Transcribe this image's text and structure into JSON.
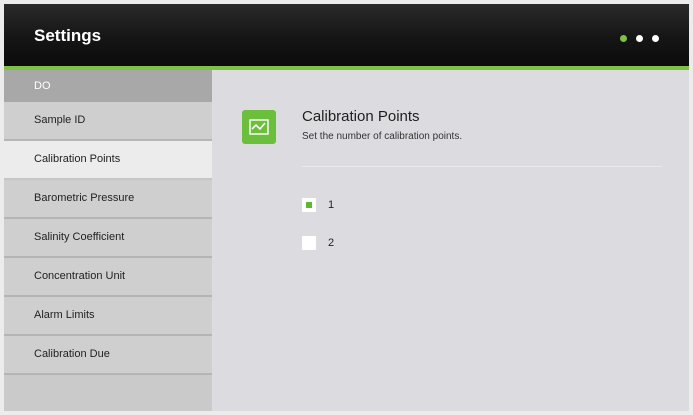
{
  "header": {
    "title": "Settings"
  },
  "sidebar": {
    "group_label": "DO",
    "items": [
      {
        "label": "Sample ID"
      },
      {
        "label": "Calibration Points"
      },
      {
        "label": "Barometric Pressure"
      },
      {
        "label": "Salinity Coefficient"
      },
      {
        "label": "Concentration Unit"
      },
      {
        "label": "Alarm Limits"
      },
      {
        "label": "Calibration Due"
      }
    ],
    "selected": "Calibration Points"
  },
  "main": {
    "icon": "chart-line-icon",
    "title": "Calibration Points",
    "description": "Set the number of calibration points.",
    "options": [
      {
        "label": "1",
        "selected": true
      },
      {
        "label": "2",
        "selected": false
      }
    ]
  },
  "colors": {
    "accent": "#7dc242",
    "header_bg": "#151515",
    "sidebar_bg": "#cacaca",
    "selected_bg": "#ececec",
    "main_bg": "#dcdce0"
  }
}
